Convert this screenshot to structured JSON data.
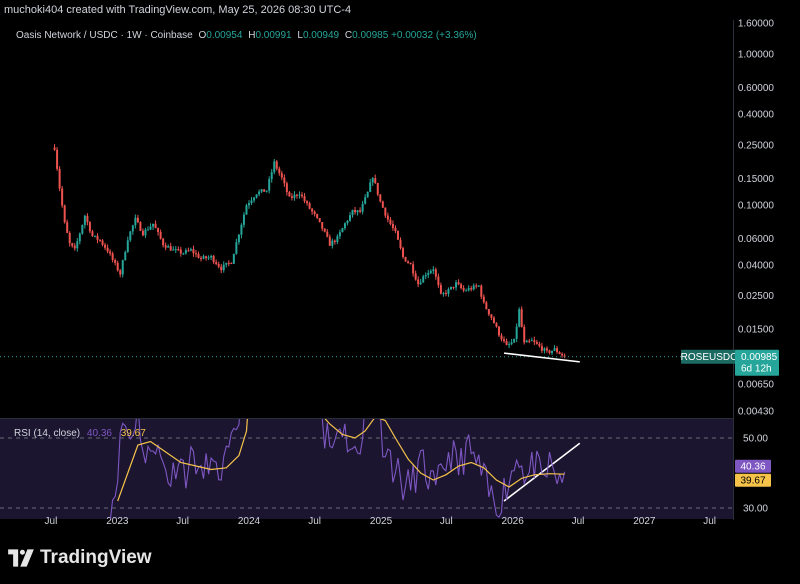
{
  "header": {
    "attribution": "muchoki404 created with TradingView.com, May 25, 2026 08:30 UTC-4"
  },
  "legend": {
    "symbol": "Oasis Network / USDC · 1W · Coinbase",
    "o_label": "O",
    "o": "0.00954",
    "h_label": "H",
    "h": "0.00991",
    "l_label": "L",
    "l": "0.00949",
    "c_label": "C",
    "c": "0.00985",
    "change": "+0.00032 (+3.36%)"
  },
  "rsi_legend": {
    "label": "RSI (14, close)",
    "rsi": "40.36",
    "ma": "39.67"
  },
  "brand": {
    "name": "TradingView"
  },
  "colors": {
    "up": "#26a69a",
    "down": "#ef5350",
    "rsi": "#7e57c2",
    "rsi_ma": "#f5c34a",
    "trendline": "#ffffff",
    "background": "#000000",
    "rsi_band": "#1b1530"
  },
  "chart_data": {
    "type": "candlestick",
    "symbol_badge": "ROSEUSDC",
    "last_price": "0.00985",
    "countdown": "6d 12h",
    "y_scale": "log",
    "y_ticks": [
      "1.60000",
      "1.00000",
      "0.60000",
      "0.40000",
      "0.25000",
      "0.15000",
      "0.10000",
      "0.06000",
      "0.04000",
      "0.02500",
      "0.01500",
      "0.00650",
      "0.00430"
    ],
    "x_ticks": [
      "Jul",
      "2023",
      "Jul",
      "2024",
      "Jul",
      "2025",
      "Jul",
      "2026",
      "Jul",
      "2027",
      "Jul"
    ],
    "price_path": [
      [
        "2022-07-11",
        0.24
      ],
      [
        "2022-07-25",
        0.13
      ],
      [
        "2022-08-08",
        0.075
      ],
      [
        "2022-08-22",
        0.055
      ],
      [
        "2022-09-05",
        0.05
      ],
      [
        "2022-09-19",
        0.065
      ],
      [
        "2022-10-03",
        0.085
      ],
      [
        "2022-10-24",
        0.062
      ],
      [
        "2022-11-14",
        0.058
      ],
      [
        "2022-12-05",
        0.05
      ],
      [
        "2022-12-26",
        0.04
      ],
      [
        "2023-01-09",
        0.035
      ],
      [
        "2023-01-30",
        0.06
      ],
      [
        "2023-02-20",
        0.08
      ],
      [
        "2023-03-13",
        0.065
      ],
      [
        "2023-04-10",
        0.075
      ],
      [
        "2023-05-08",
        0.055
      ],
      [
        "2023-06-05",
        0.05
      ],
      [
        "2023-07-03",
        0.048
      ],
      [
        "2023-07-24",
        0.05
      ],
      [
        "2023-08-21",
        0.044
      ],
      [
        "2023-09-18",
        0.045
      ],
      [
        "2023-10-16",
        0.038
      ],
      [
        "2023-11-13",
        0.042
      ],
      [
        "2023-12-04",
        0.065
      ],
      [
        "2023-12-25",
        0.1
      ],
      [
        "2024-01-22",
        0.12
      ],
      [
        "2024-02-19",
        0.125
      ],
      [
        "2024-03-11",
        0.19
      ],
      [
        "2024-04-01",
        0.15
      ],
      [
        "2024-04-22",
        0.11
      ],
      [
        "2024-05-20",
        0.12
      ],
      [
        "2024-06-10",
        0.1
      ],
      [
        "2024-07-01",
        0.085
      ],
      [
        "2024-07-22",
        0.07
      ],
      [
        "2024-08-12",
        0.055
      ],
      [
        "2024-09-02",
        0.06
      ],
      [
        "2024-09-23",
        0.075
      ],
      [
        "2024-10-14",
        0.09
      ],
      [
        "2024-11-04",
        0.09
      ],
      [
        "2024-11-25",
        0.12
      ],
      [
        "2024-12-09",
        0.155
      ],
      [
        "2024-12-30",
        0.105
      ],
      [
        "2025-01-20",
        0.08
      ],
      [
        "2025-02-10",
        0.065
      ],
      [
        "2025-03-03",
        0.045
      ],
      [
        "2025-03-24",
        0.04
      ],
      [
        "2025-04-14",
        0.03
      ],
      [
        "2025-05-05",
        0.035
      ],
      [
        "2025-05-26",
        0.038
      ],
      [
        "2025-06-16",
        0.025
      ],
      [
        "2025-07-07",
        0.027
      ],
      [
        "2025-07-28",
        0.03
      ],
      [
        "2025-08-18",
        0.027
      ],
      [
        "2025-09-08",
        0.028
      ],
      [
        "2025-09-29",
        0.029
      ],
      [
        "2025-10-13",
        0.022
      ],
      [
        "2025-11-03",
        0.018
      ],
      [
        "2025-11-24",
        0.014
      ],
      [
        "2025-12-15",
        0.0115
      ],
      [
        "2026-01-05",
        0.0125
      ],
      [
        "2026-01-19",
        0.02
      ],
      [
        "2026-02-02",
        0.012
      ],
      [
        "2026-02-23",
        0.0125
      ],
      [
        "2026-03-16",
        0.0115
      ],
      [
        "2026-04-06",
        0.0105
      ],
      [
        "2026-04-27",
        0.011
      ],
      [
        "2026-05-25",
        0.00985
      ]
    ],
    "trendlines": [
      {
        "pane": "price",
        "from": [
          "2025-12-08",
          0.0104
        ],
        "to": [
          "2026-07-06",
          0.0091
        ]
      },
      {
        "pane": "rsi",
        "from": [
          "2025-12-08",
          32.0
        ],
        "to": [
          "2026-07-06",
          48.5
        ]
      }
    ],
    "rsi": {
      "label": "RSI (14, close)",
      "levels": [
        30.0,
        50.0
      ],
      "y_ticks": [
        "50.00",
        "30.00"
      ],
      "path": [
        [
          "2022-12-12",
          30.5
        ],
        [
          "2022-12-26",
          35
        ],
        [
          "2023-01-16",
          55
        ],
        [
          "2023-02-06",
          50
        ],
        [
          "2023-02-27",
          58
        ],
        [
          "2023-03-20",
          42
        ],
        [
          "2023-04-10",
          50
        ],
        [
          "2023-05-01",
          44
        ],
        [
          "2023-05-29",
          38
        ],
        [
          "2023-06-19",
          45
        ],
        [
          "2023-07-10",
          40
        ],
        [
          "2023-07-31",
          46
        ],
        [
          "2023-08-21",
          38
        ],
        [
          "2023-09-11",
          44
        ],
        [
          "2023-10-02",
          39
        ],
        [
          "2023-10-23",
          42
        ],
        [
          "2023-11-13",
          47
        ],
        [
          "2023-12-04",
          56
        ],
        [
          "2023-12-18",
          66
        ]
      ],
      "path2": [
        [
          "2024-07-08",
          70
        ],
        [
          "2024-07-29",
          52
        ],
        [
          "2024-08-19",
          47
        ],
        [
          "2024-09-09",
          55
        ],
        [
          "2024-09-30",
          50
        ],
        [
          "2024-10-21",
          44
        ],
        [
          "2024-11-11",
          53
        ],
        [
          "2024-12-02",
          68
        ],
        [
          "2024-12-16",
          62
        ],
        [
          "2025-01-06",
          50
        ],
        [
          "2025-01-27",
          44
        ],
        [
          "2025-02-17",
          40
        ],
        [
          "2025-03-10",
          35
        ],
        [
          "2025-03-31",
          38
        ],
        [
          "2025-04-21",
          43
        ],
        [
          "2025-05-12",
          39
        ],
        [
          "2025-06-02",
          34
        ],
        [
          "2025-06-23",
          42
        ],
        [
          "2025-07-14",
          46
        ],
        [
          "2025-08-04",
          41
        ],
        [
          "2025-08-25",
          47
        ],
        [
          "2025-09-15",
          44
        ],
        [
          "2025-10-06",
          40
        ],
        [
          "2025-10-27",
          34
        ],
        [
          "2025-11-17",
          31
        ],
        [
          "2025-12-08",
          35
        ],
        [
          "2025-12-29",
          40
        ],
        [
          "2026-01-19",
          46
        ],
        [
          "2026-02-09",
          38
        ],
        [
          "2026-03-02",
          43
        ],
        [
          "2026-03-23",
          37
        ],
        [
          "2026-04-13",
          42
        ],
        [
          "2026-05-04",
          39
        ],
        [
          "2026-05-25",
          40.36
        ]
      ],
      "ma_path": [
        [
          "2023-01-02",
          32
        ],
        [
          "2023-01-30",
          40
        ],
        [
          "2023-02-27",
          48
        ],
        [
          "2023-04-03",
          49
        ],
        [
          "2023-05-15",
          46
        ],
        [
          "2023-06-26",
          43
        ],
        [
          "2023-08-07",
          42
        ],
        [
          "2023-09-18",
          41
        ],
        [
          "2023-10-30",
          41.5
        ],
        [
          "2023-12-04",
          45
        ],
        [
          "2023-12-25",
          52
        ]
      ],
      "ma_path2": [
        [
          "2024-07-08",
          58
        ],
        [
          "2024-08-12",
          54
        ],
        [
          "2024-09-16",
          51
        ],
        [
          "2024-10-21",
          50
        ],
        [
          "2024-11-18",
          52
        ],
        [
          "2024-12-16",
          56
        ],
        [
          "2025-01-13",
          55
        ],
        [
          "2025-02-10",
          50
        ],
        [
          "2025-03-17",
          44
        ],
        [
          "2025-04-21",
          40
        ],
        [
          "2025-05-26",
          38
        ],
        [
          "2025-06-30",
          39.5
        ],
        [
          "2025-08-04",
          42
        ],
        [
          "2025-09-08",
          43
        ],
        [
          "2025-10-13",
          41.5
        ],
        [
          "2025-11-17",
          38
        ],
        [
          "2025-12-22",
          36
        ],
        [
          "2026-01-26",
          38.5
        ],
        [
          "2026-03-02",
          39.5
        ],
        [
          "2026-04-13",
          39.8
        ],
        [
          "2026-05-25",
          39.67
        ]
      ]
    }
  }
}
